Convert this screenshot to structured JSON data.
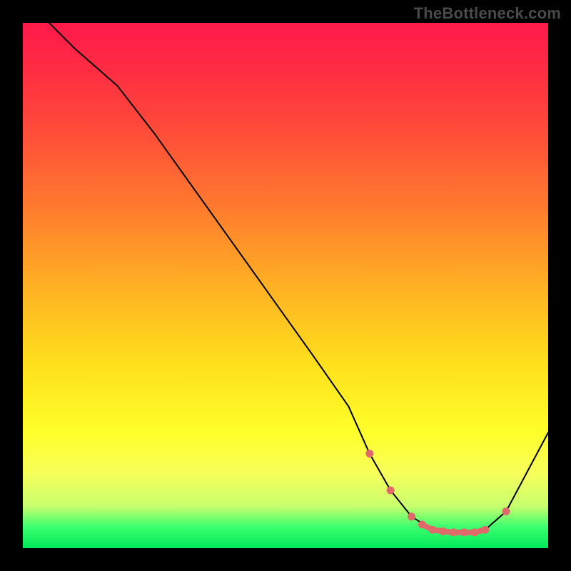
{
  "watermark": "TheBottleneck.com",
  "chart_data": {
    "type": "line",
    "title": "",
    "xlabel": "",
    "ylabel": "",
    "xlim": [
      0,
      100
    ],
    "ylim": [
      0,
      100
    ],
    "grid": false,
    "series": [
      {
        "name": "curve",
        "x": [
          5,
          10,
          18,
          25,
          35,
          45,
          55,
          62,
          66,
          70,
          74,
          78,
          82,
          86,
          88,
          92,
          100
        ],
        "y": [
          100,
          95,
          88,
          79,
          65,
          51,
          37,
          27,
          18,
          11,
          6,
          3.5,
          3,
          3,
          3.5,
          7,
          22
        ]
      }
    ],
    "markers": {
      "name": "highlighted-points",
      "x": [
        66,
        70,
        74,
        76,
        78,
        80,
        82,
        84,
        86,
        88,
        92
      ],
      "y": [
        18,
        11,
        6,
        4.5,
        3.5,
        3.2,
        3,
        3,
        3,
        3.5,
        7
      ]
    },
    "background_gradient": {
      "stops": [
        {
          "pos": 0.0,
          "color": "#ff1a4b"
        },
        {
          "pos": 0.35,
          "color": "#ff7a2e"
        },
        {
          "pos": 0.65,
          "color": "#ffe01c"
        },
        {
          "pos": 0.86,
          "color": "#f6ff5c"
        },
        {
          "pos": 0.96,
          "color": "#3bff6e"
        },
        {
          "pos": 1.0,
          "color": "#00e85a"
        }
      ]
    }
  }
}
